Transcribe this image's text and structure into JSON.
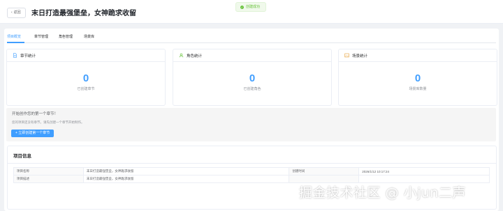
{
  "header": {
    "back_label": "返回",
    "title": "末日打造最强堡垒，女神跪求收留"
  },
  "toast": {
    "text": "创建成功",
    "color": "#67c23a"
  },
  "tabs": [
    {
      "label": "项目概览",
      "active": true
    },
    {
      "label": "章节管理",
      "active": false
    },
    {
      "label": "角色管理",
      "active": false
    },
    {
      "label": "场景库",
      "active": false
    }
  ],
  "stats": [
    {
      "icon": "document-icon",
      "title": "章节统计",
      "value": "0",
      "label": "已创建章节",
      "icon_color": "#409eff"
    },
    {
      "icon": "user-icon",
      "title": "角色统计",
      "value": "0",
      "label": "已创建角色",
      "icon_color": "#67c23a"
    },
    {
      "icon": "image-icon",
      "title": "场景统计",
      "value": "0",
      "label": "场景库数量",
      "icon_color": "#e6a23c"
    }
  ],
  "empty": {
    "title": "开始创作您的第一个章节！",
    "desc": "您的项目还没有章节。请先创建一个章节开始制作。",
    "button": "+ 立即创建第一个章节"
  },
  "info": {
    "title": "项目信息",
    "rows": [
      {
        "label1": "项目名称",
        "value1": "末日打造最强堡垒，女神跪求收留",
        "label2": "创建时间",
        "value2": "2026/1/12 10:17:24"
      },
      {
        "label1": "项目描述",
        "value1": "末日打造最强堡垒，女神跪求收留",
        "label2": "",
        "value2": ""
      }
    ]
  },
  "watermark": "掘金技术社区 @ 小jun二声",
  "colors": {
    "accent": "#409eff",
    "success": "#67c23a",
    "warning": "#e6a23c"
  }
}
